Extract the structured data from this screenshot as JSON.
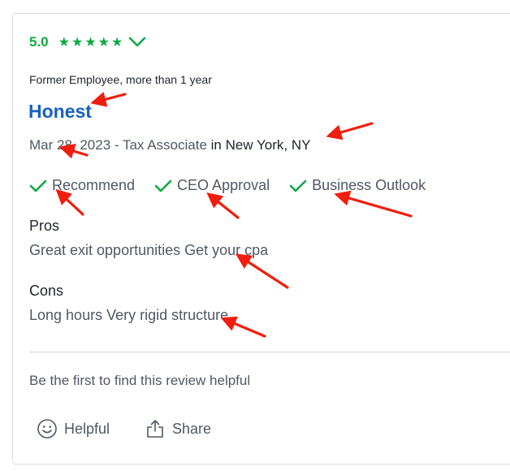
{
  "review": {
    "rating": "5.0",
    "stars": "★★★★★",
    "employment": "Former Employee, more than 1 year",
    "headline": "Honest",
    "date_title": "Mar 28, 2023 - Tax Associate ",
    "location": "in New York, NY",
    "indicators": [
      {
        "label": "Recommend",
        "icon": "check-icon"
      },
      {
        "label": "CEO Approval",
        "icon": "check-icon"
      },
      {
        "label": "Business Outlook",
        "icon": "check-icon"
      }
    ],
    "pros_title": "Pros",
    "pros_text": "Great exit opportunities Get your cpa",
    "cons_title": "Cons",
    "cons_text": "Long hours Very rigid structure",
    "helpful_prompt": "Be the first to find this review helpful",
    "actions": {
      "helpful_label": "Helpful",
      "share_label": "Share"
    }
  },
  "colors": {
    "rating_green": "#0caa41",
    "headline_blue": "#1861bf",
    "annotation_red": "#f21d0c"
  }
}
